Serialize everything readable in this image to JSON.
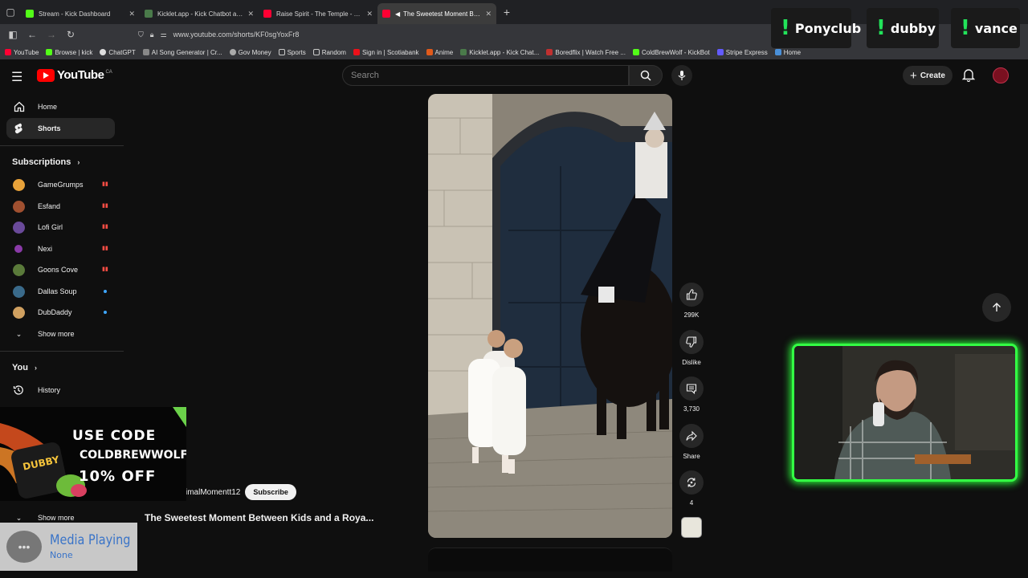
{
  "browser": {
    "tabs": [
      {
        "title": "Stream - Kick Dashboard",
        "favicon_color": "#53fc18",
        "active": false
      },
      {
        "title": "Kicklet.app - Kick Chatbot and C",
        "favicon_color": "#4a7a4a",
        "active": false
      },
      {
        "title": "Raise Spirit - The Temple - YouT",
        "favicon_color": "#ff0033",
        "active": false
      },
      {
        "title": "The Sweetest Moment Betw",
        "favicon_color": "#ff0033",
        "active": true
      }
    ],
    "new_tab_icon": "plus-icon",
    "url": "www.youtube.com/shorts/KF0sgYoxFr8",
    "bookmarks": [
      {
        "label": "YouTube",
        "color": "#ff0033"
      },
      {
        "label": "Browse | kick",
        "color": "#53fc18"
      },
      {
        "label": "ChatGPT",
        "color": "#dddddd"
      },
      {
        "label": "AI Song Generator | Cr...",
        "color": "#888888"
      },
      {
        "label": "Gov Money",
        "color": "#aaaaaa"
      },
      {
        "label": "Sports",
        "color": "#cccccc"
      },
      {
        "label": "Random",
        "color": "#cccccc"
      },
      {
        "label": "Sign in | Scotiabank",
        "color": "#ec111a"
      },
      {
        "label": "Anime",
        "color": "#e05a1b"
      },
      {
        "label": "Kicklet.app - Kick Chat...",
        "color": "#4a7a4a"
      },
      {
        "label": "Boredflix | Watch Free ...",
        "color": "#c03030"
      },
      {
        "label": "ColdBrewWolf - KickBot",
        "color": "#53fc18"
      },
      {
        "label": "Stripe Express",
        "color": "#635bff"
      },
      {
        "label": "Home",
        "color": "#4a90d9"
      }
    ]
  },
  "header": {
    "logo_text": "YouTube",
    "country_code": "CA",
    "search_placeholder": "Search",
    "create_label": "Create"
  },
  "sidebar": {
    "main_items": [
      {
        "label": "Home",
        "icon": "home-icon"
      },
      {
        "label": "Shorts",
        "icon": "shorts-icon"
      }
    ],
    "subscriptions_title": "Subscriptions",
    "subscriptions": [
      {
        "name": "GameGrumps",
        "color": "#e8a23a",
        "indicator": "live"
      },
      {
        "name": "Esfand",
        "color": "#a05030",
        "indicator": "live"
      },
      {
        "name": "Lofi Girl",
        "color": "#6a4a9a",
        "indicator": "live"
      },
      {
        "name": "Nexi",
        "color": "#8a3aa8",
        "indicator": "live"
      },
      {
        "name": "Goons Cove",
        "color": "#5a7a3a",
        "indicator": "live"
      },
      {
        "name": "Dallas Soup",
        "color": "#3a6a8a",
        "indicator": "new"
      },
      {
        "name": "DubDaddy",
        "color": "#d0a060",
        "indicator": "new"
      }
    ],
    "show_more_label": "Show more",
    "you_title": "You",
    "history_label": "History",
    "bottom_show_more_label": "Show more"
  },
  "short": {
    "like_count": "299K",
    "dislike_label": "Dislike",
    "comment_count": "3,730",
    "share_label": "Share",
    "remix_count": "4",
    "channel_name": "imalMomentt12",
    "subscribe_label": "Subscribe",
    "title": "The Sweetest Moment Between Kids and a Roya..."
  },
  "overlays": {
    "promo_line1": "USE CODE",
    "promo_line2": "COLDBREWWOLF",
    "promo_line3": "10% OFF",
    "promo_brand": "DUBBY",
    "media_title": "Media Playing",
    "media_sub": "None",
    "chat_chips": [
      {
        "name": "Ponyclub"
      },
      {
        "name": "dubby"
      },
      {
        "name": "vance"
      }
    ],
    "accent_green": "#33ff44"
  }
}
